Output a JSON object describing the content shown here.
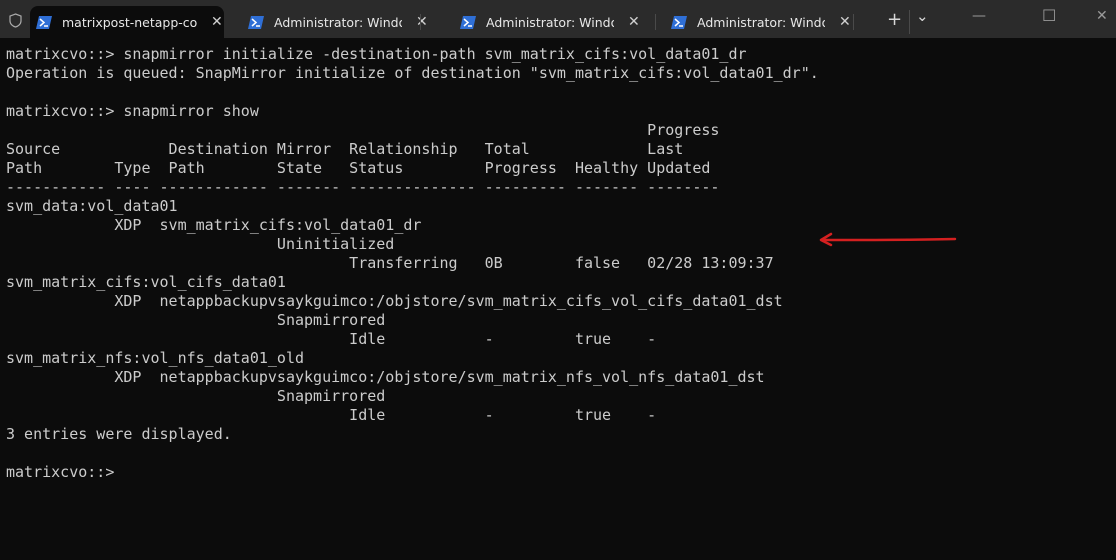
{
  "tabs": [
    {
      "label": "matrixpost-netapp-conn",
      "active": true
    },
    {
      "label": "Administrator: Windows PowerShell",
      "active": false
    },
    {
      "label": "Administrator: Windows PowerShell",
      "active": false
    },
    {
      "label": "Administrator: Windows PowerShell",
      "active": false
    }
  ],
  "controls": {
    "new_tab": "+",
    "dropdown": "⌄",
    "minimize": "—",
    "maximize": "☐",
    "close": "✕",
    "tab_close": "✕"
  },
  "terminal": {
    "lines": [
      "matrixcvo::> snapmirror initialize -destination-path svm_matrix_cifs:vol_data01_dr",
      "Operation is queued: SnapMirror initialize of destination \"svm_matrix_cifs:vol_data01_dr\".",
      "",
      "matrixcvo::> snapmirror show",
      "                                                                       Progress",
      "Source            Destination Mirror  Relationship   Total             Last",
      "Path        Type  Path        State   Status         Progress  Healthy Updated",
      "----------- ---- ------------ ------- -------------- --------- ------- --------",
      "svm_data:vol_data01",
      "            XDP  svm_matrix_cifs:vol_data01_dr",
      "                              Uninitialized",
      "                                      Transferring   0B        false   02/28 13:09:37",
      "svm_matrix_cifs:vol_cifs_data01",
      "            XDP  netappbackupvsaykguimco:/objstore/svm_matrix_cifs_vol_cifs_data01_dst",
      "                              Snapmirrored",
      "                                      Idle           -         true    -",
      "svm_matrix_nfs:vol_nfs_data01_old",
      "            XDP  netappbackupvsaykguimco:/objstore/svm_matrix_nfs_vol_nfs_data01_dst",
      "                              Snapmirrored",
      "                                      Idle           -         true    -",
      "3 entries were displayed.",
      "",
      "matrixcvo::> "
    ]
  },
  "colors": {
    "annotation_arrow": "#d42020",
    "powershell_icon": "#2f6fd6"
  }
}
